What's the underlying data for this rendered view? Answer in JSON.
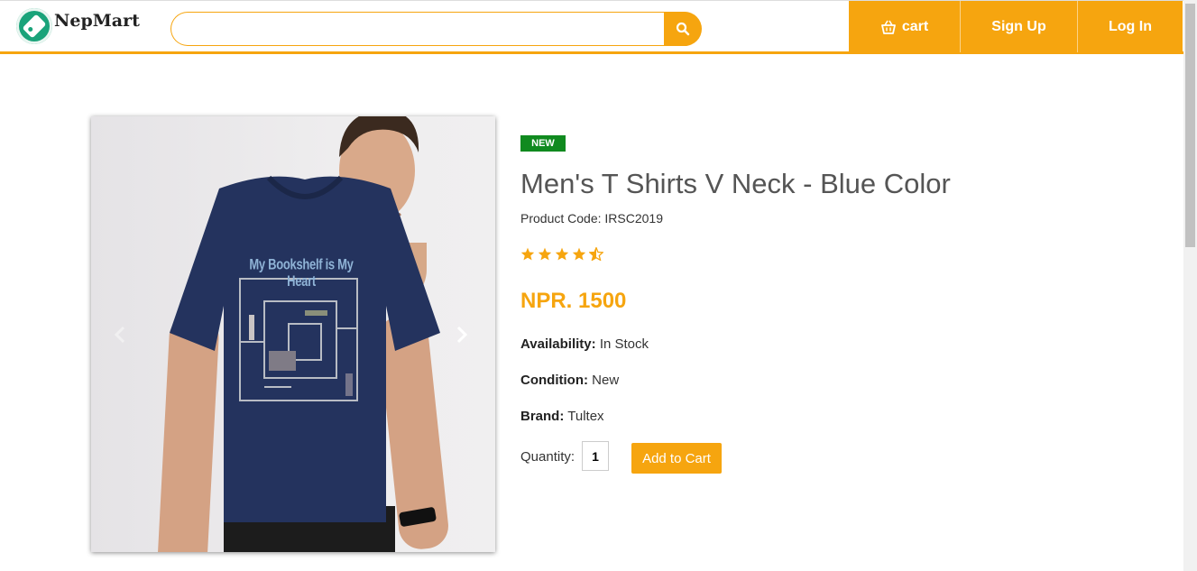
{
  "brand": {
    "name": "NepMart"
  },
  "search": {
    "placeholder": "",
    "value": ""
  },
  "nav": {
    "cart_label": "cart",
    "signup_label": "Sign Up",
    "login_label": "Log In"
  },
  "product": {
    "badge": "NEW",
    "title": "Men's T Shirts V Neck - Blue Color",
    "code_label": "Product Code:",
    "code": "IRSC2019",
    "rating": 4.5,
    "rating_max": 5,
    "price": "NPR. 1500",
    "availability_label": "Availability:",
    "availability": "In Stock",
    "condition_label": "Condition:",
    "condition": "New",
    "brand_label": "Brand:",
    "brand": "Tultex",
    "quantity_label": "Quantity:",
    "quantity": "1",
    "add_to_cart_label": "Add to Cart",
    "image_print_text": "My Bookshelf is My Heart"
  },
  "colors": {
    "accent": "#f6a50f",
    "badge": "#108a1f",
    "shirt": "#24335e"
  }
}
